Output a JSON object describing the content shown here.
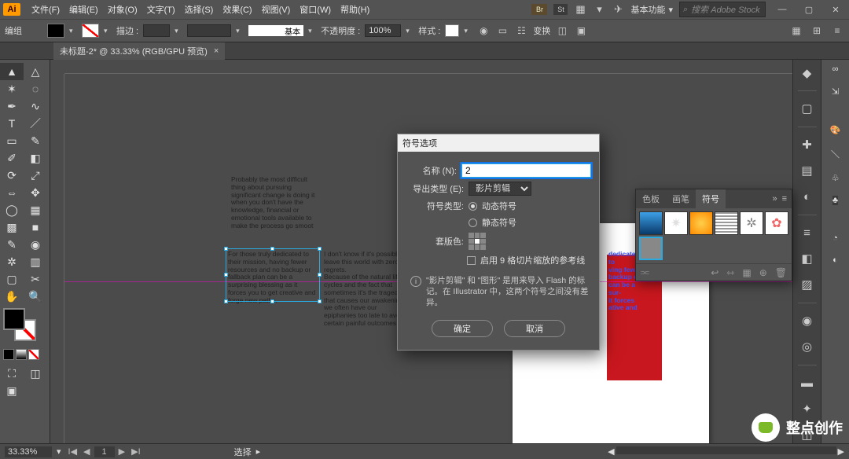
{
  "app": {
    "logo": "Ai"
  },
  "menu": {
    "file": "文件(F)",
    "edit": "编辑(E)",
    "object": "对象(O)",
    "type": "文字(T)",
    "select": "选择(S)",
    "effect": "效果(C)",
    "view": "视图(V)",
    "window": "窗口(W)",
    "help": "帮助(H)"
  },
  "workspace_label": "基本功能",
  "stock_placeholder": "搜索 Adobe Stock",
  "control": {
    "edit_label": "编组",
    "stroke_label": "描边 :",
    "stroke_size": "",
    "stroke_style": "基本",
    "opacity_label": "不透明度 :",
    "opacity_value": "100%",
    "style_label": "样式 :",
    "transform_label": "变换"
  },
  "tab": {
    "title": "未标题-2* @ 33.33% (RGB/GPU 预览)"
  },
  "text_blocks": {
    "tb1": "Probably the most difficult thing about pursuing significant change is doing it when you don't have the knowledge, financial or emotional tools available to make the process go smoot",
    "tb2": "For those truly dedicated to their mission, having fewer resources and no backup or fallback plan can be a surprising blessing as it forces you to get creative and forge new paths.",
    "tb3": "I don't know if it's possible to leave this world with zero regrets.\nBecause of the natural life cycles and the fact that sometimes it's the tragedy that causes our awakenings we often have our epiphanies too late to avoid certain painful outcomes.",
    "tb_red": "dedicated to\nving fewer\nbackup or\ncan be a sur-\nit forces\native and"
  },
  "dialog": {
    "title": "符号选项",
    "name_label": "名称 (N):",
    "name_value": "2",
    "export_label": "导出类型 (E):",
    "export_value": "影片剪辑",
    "symtype_label": "符号类型:",
    "symtype_dynamic": "动态符号",
    "symtype_static": "静态符号",
    "reg_label": "套版色:",
    "grid_guides": "启用 9 格切片缩放的参考线",
    "info": "\"影片剪辑\" 和 \"图形\" 是用来导入 Flash 的标记。在 Illustrator 中，这两个符号之间没有差异。",
    "ok": "确定",
    "cancel": "取消"
  },
  "symbols_panel": {
    "tab_swatch": "色板",
    "tab_brush": "画笔",
    "tab_symbol": "符号"
  },
  "status": {
    "zoom": "33.33%",
    "page": "1",
    "tool_hint": "选择"
  },
  "watermark": "整点创作"
}
